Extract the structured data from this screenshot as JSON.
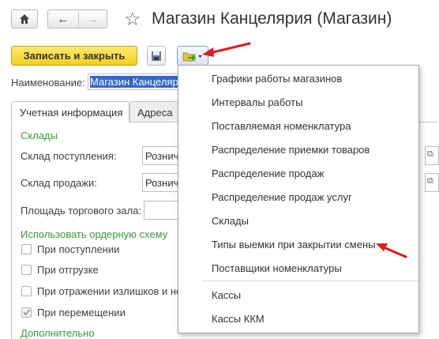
{
  "window": {
    "title": "Магазин Канцелярия (Магазин)"
  },
  "toolbar": {
    "save_close_label": "Записать и закрыть"
  },
  "form": {
    "name_label": "Наименование:",
    "name_value": "Магазин Канцелярия",
    "tabs": [
      {
        "label": "Учетная информация",
        "active": true
      },
      {
        "label": "Адреса",
        "active": false
      }
    ],
    "warehouses_section": "Склады",
    "receipt_label": "Склад поступления:",
    "receipt_value": "Розничный склад",
    "sales_label": "Склад продажи:",
    "sales_value": "Розничный склад",
    "area_label": "Площадь торгового зала:",
    "order_scheme_section": "Использовать ордерную схему",
    "checkboxes": [
      {
        "label": "При поступлении",
        "checked": false
      },
      {
        "label": "При отгрузке",
        "checked": false
      },
      {
        "label": "При отражении излишков и недостач",
        "checked": false
      },
      {
        "label": "При перемещении",
        "checked": true
      }
    ],
    "additional_section": "Дополнительно"
  },
  "menu": {
    "items": [
      "Графики работы магазинов",
      "Интервалы работы",
      "Поставляемая номенклатура",
      "Распределение приемки товаров",
      "Распределение продаж",
      "Распределение продаж услуг",
      "Склады",
      "Типы выемки при закрытии смены",
      "Поставщики номенклатуры",
      "Кассы",
      "Кассы ККМ"
    ]
  },
  "colors": {
    "accent_yellow": "#f5cf1e",
    "section_green": "#3a9a3a",
    "arrow_red": "#e01b1b",
    "selection_blue": "#3366cc"
  }
}
